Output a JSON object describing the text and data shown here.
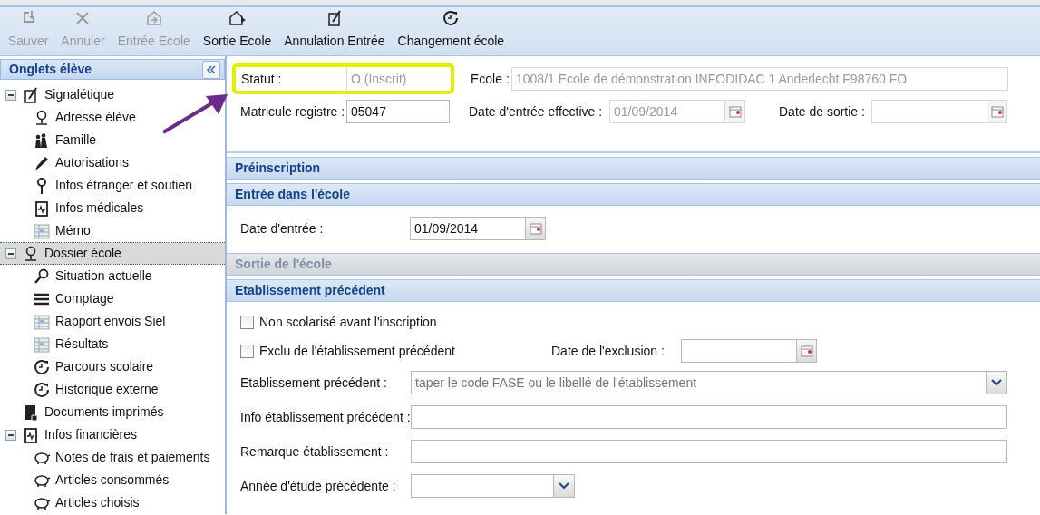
{
  "toolbar": [
    {
      "label": "Sauver",
      "disabled": true
    },
    {
      "label": "Annuler",
      "disabled": true
    },
    {
      "label": "Entrée Ecole",
      "disabled": true
    },
    {
      "label": "Sortie Ecole",
      "disabled": false
    },
    {
      "label": "Annulation Entrée",
      "disabled": false
    },
    {
      "label": "Changement école",
      "disabled": false
    }
  ],
  "sidebar": {
    "title": "Onglets élève",
    "items": [
      {
        "label": "Signalétique",
        "expanded": true,
        "selected": false,
        "children": [
          {
            "label": "Adresse élève",
            "selected": false
          },
          {
            "label": "Famille",
            "selected": false
          },
          {
            "label": "Autorisations",
            "selected": false
          },
          {
            "label": "Infos étranger et soutien",
            "selected": false
          },
          {
            "label": "Infos médicales",
            "selected": false
          },
          {
            "label": "Mémo",
            "selected": false
          }
        ]
      },
      {
        "label": "Dossier école",
        "expanded": true,
        "selected": true,
        "children": [
          {
            "label": "Situation actuelle",
            "selected": false
          },
          {
            "label": "Comptage",
            "selected": false
          },
          {
            "label": "Rapport envois Siel",
            "selected": false
          },
          {
            "label": "Résultats",
            "selected": false
          },
          {
            "label": "Parcours scolaire",
            "selected": false
          },
          {
            "label": "Historique externe",
            "selected": false
          }
        ]
      },
      {
        "label": "Documents imprimés",
        "selected": false
      },
      {
        "label": "Infos financières",
        "expanded": true,
        "selected": false,
        "children": [
          {
            "label": "Notes de frais et paiements",
            "selected": false
          },
          {
            "label": "Articles consommés",
            "selected": false
          },
          {
            "label": "Articles choisis",
            "selected": false
          }
        ]
      }
    ]
  },
  "identity": {
    "statut": {
      "label": "Statut :",
      "value": "O (Inscrit)",
      "disabled": true,
      "highlighted": true
    },
    "ecole": {
      "label": "Ecole :",
      "value": "1008/1 Ecole de démonstration INFODIDAC 1 Anderlecht F98760 FO",
      "disabled": true
    },
    "matricule": {
      "label": "Matricule registre :",
      "value": "05047",
      "disabled": false
    },
    "date_entree_effective": {
      "label": "Date d'entrée effective :",
      "value": "01/09/2014",
      "disabled": true
    },
    "date_sortie": {
      "label": "Date de sortie :",
      "disabled": true
    }
  },
  "sections": [
    {
      "title": "Préinscription",
      "disabled": false
    },
    {
      "title": "Entrée dans l'école",
      "disabled": false,
      "fields": [
        {
          "kind": "date",
          "label": "Date d'entrée :",
          "value": "01/09/2014"
        }
      ]
    },
    {
      "title": "Sortie de l'école",
      "disabled": true
    },
    {
      "title": "Etablissement précédent",
      "disabled": false,
      "fields": [
        {
          "kind": "checkbox",
          "label": "Non scolarisé avant l'inscription",
          "checked": false
        },
        {
          "kind": "checkbox",
          "label": "Exclu de l'établissement précédent",
          "checked": false,
          "date_label": "Date de l'exclusion :"
        },
        {
          "kind": "combo",
          "label": "Etablissement précédent :",
          "placeholder": "taper le code FASE ou le libellé de l'établissement"
        },
        {
          "kind": "text",
          "label": "Info établissement précédent :"
        },
        {
          "kind": "text",
          "label": "Remarque établissement :"
        },
        {
          "kind": "select",
          "label": "Année d'étude précédente :"
        }
      ]
    }
  ]
}
